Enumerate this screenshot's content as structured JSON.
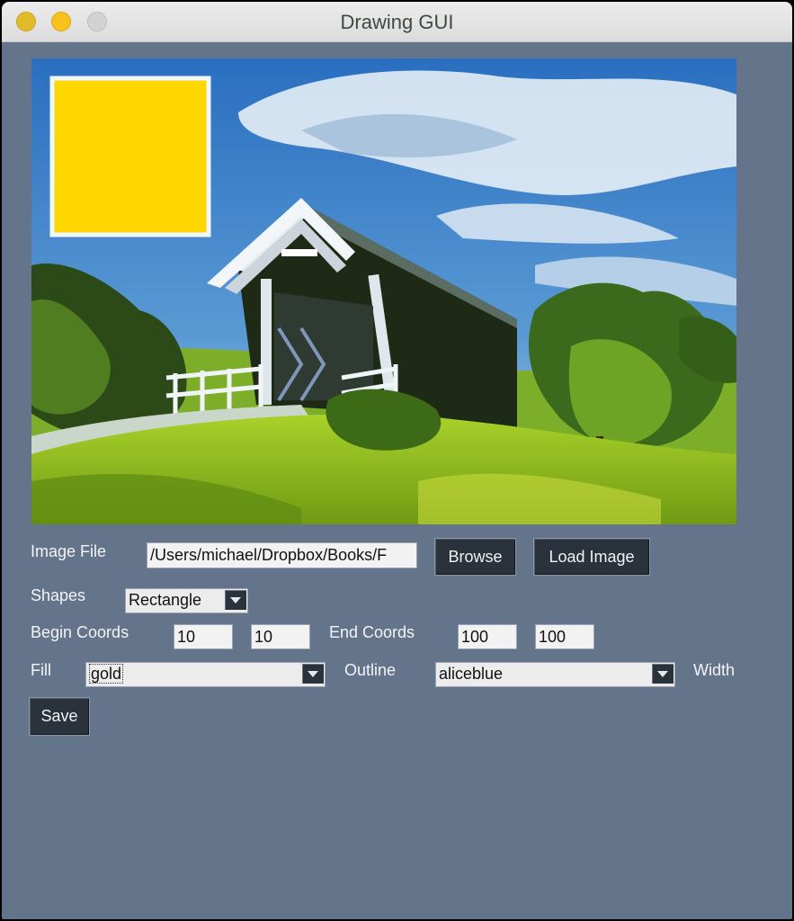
{
  "window": {
    "title": "Drawing GUI"
  },
  "canvas": {
    "shape": {
      "type": "Rectangle",
      "fill": "#ffd700",
      "outline": "#f0f8ff"
    }
  },
  "form": {
    "image_file": {
      "label": "Image File",
      "value": "/Users/michael/Dropbox/Books/F"
    },
    "browse_label": "Browse",
    "load_label": "Load Image",
    "shapes": {
      "label": "Shapes",
      "value": "Rectangle"
    },
    "begin": {
      "label": "Begin Coords",
      "x": "10",
      "y": "10"
    },
    "end": {
      "label": "End Coords",
      "x": "100",
      "y": "100"
    },
    "fill": {
      "label": "Fill",
      "value": "gold"
    },
    "outline": {
      "label": "Outline",
      "value": "aliceblue"
    },
    "width_label": "Width",
    "save_label": "Save"
  }
}
